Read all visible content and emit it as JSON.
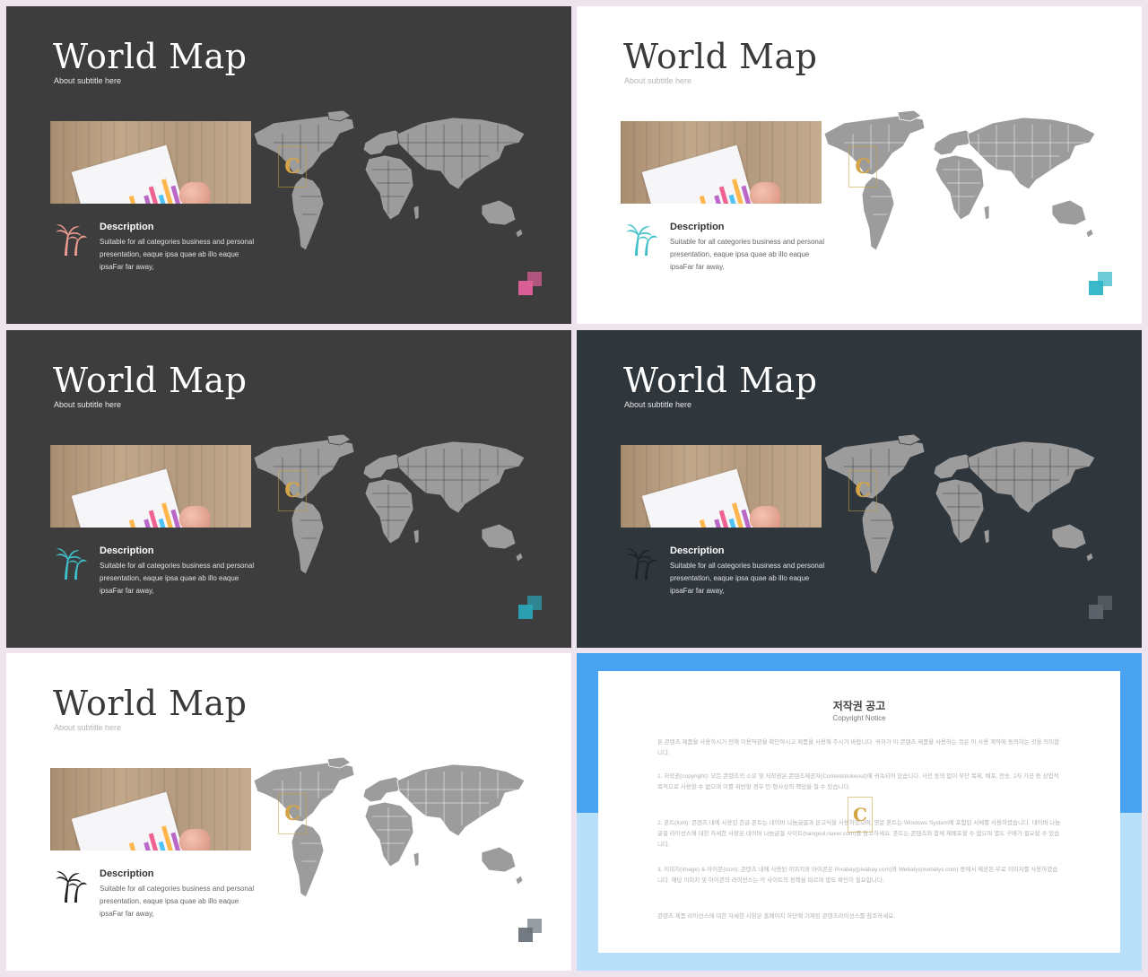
{
  "slides": [
    {
      "title": "World Map",
      "subtitle": "About subtitle here",
      "description_title": "Description",
      "description_text": "Suitable for all categories business and personal presentation, eaque ipsa quae ab illo eaque ipsaFar far away,",
      "logo_letter": "C",
      "palm_color": "#ee9b8f",
      "square_color": "#e0609a",
      "map_color": "#9c9c9c",
      "map_border_color": "#3d3d3d"
    },
    {
      "title": "World Map",
      "subtitle": "About subtitle here",
      "description_title": "Description",
      "description_text": "Suitable for all categories business and personal presentation, eaque ipsa quae ab illo eaque ipsaFar far away,",
      "logo_letter": "C",
      "palm_color": "#3fbfc9",
      "square_color": "#2fb5c8",
      "map_color": "#9c9c9c",
      "map_border_color": "#ffffff"
    },
    {
      "title": "World Map",
      "subtitle": "About subtitle here",
      "description_title": "Description",
      "description_text": "Suitable for all categories business and personal presentation, eaque ipsa quae ab illo eaque ipsaFar far away,",
      "logo_letter": "C",
      "palm_color": "#3fbfc9",
      "square_color": "#2aa4b6",
      "map_color": "#9c9c9c",
      "map_border_color": "#3d3d3d"
    },
    {
      "title": "World Map",
      "subtitle": "About subtitle here",
      "description_title": "Description",
      "description_text": "Suitable for all categories business and personal presentation, eaque ipsa quae ab illo eaque ipsaFar far away,",
      "logo_letter": "C",
      "palm_color": "#1d2327",
      "square_color": "#5e656b",
      "map_color": "#9c9c9c",
      "map_border_color": "#2f363c"
    },
    {
      "title": "World Map",
      "subtitle": "About subtitle here",
      "description_title": "Description",
      "description_text": "Suitable for all categories business and personal presentation, eaque ipsa quae ab illo eaque ipsaFar far away,",
      "logo_letter": "C",
      "palm_color": "#222222",
      "square_color": "#6b737a",
      "map_color": "#9c9c9c",
      "map_border_color": "#ffffff"
    }
  ],
  "copyright": {
    "title": "저작권 공고",
    "subtitle": "Copyright Notice",
    "logo_letter": "C",
    "paragraphs": [
      "본 콘텐츠 제품을 사용하시기 전에 이용약관을 확인하시고 제품을 사용해 주시기 바랍니다. 귀하가 이 콘텐츠 제품을 사용하는 것은 이 사용 계약에 동의하는 것을 의미합니다.",
      "1. 저작권(copyright): 모든 콘텐츠의 소유 및 저작권은 콘텐츠제공자(Contentstokeout)에 귀속되어 있습니다. 사전 동의 없이 무단 복제, 배포, 전송, 2차 가공 등 상업적 목적으로 사용할 수 없으며 이를 위반할 경우 민·형사상의 책임을 질 수 있습니다.",
      "2. 폰트(font): 콘텐츠 내에 사용된 한글 폰트는 네이버 나눔글꼴과 본고딕을 사용하였으며, 영문 폰트는 Windows System에 포함된 서체를 사용하였습니다. 네이버 나눔글꼴 라이선스에 대한 자세한 사항은 네이버 나눔글꼴 사이트(hangeul.naver.com)를 참고하세요. 폰트는 콘텐츠와 함께 재배포할 수 없으며 별도 구매가 필요할 수 있습니다.",
      "3. 이미지(image) & 아이콘(icon): 콘텐츠 내에 사용된 이미지와 아이콘은 Pixabay(pixabay.com)와 Webalys(webalys.com) 등에서 제공된 무료 이미지를 사용하였습니다. 해당 이미지 및 아이콘의 라이선스는 각 사이트의 정책을 따르며 별도 확인이 필요합니다.",
      "콘텐츠 제품 라이선스에 대한 자세한 사항은 홈페이지 하단에 기재된 콘텐츠라이선스를 참조하세요."
    ]
  }
}
